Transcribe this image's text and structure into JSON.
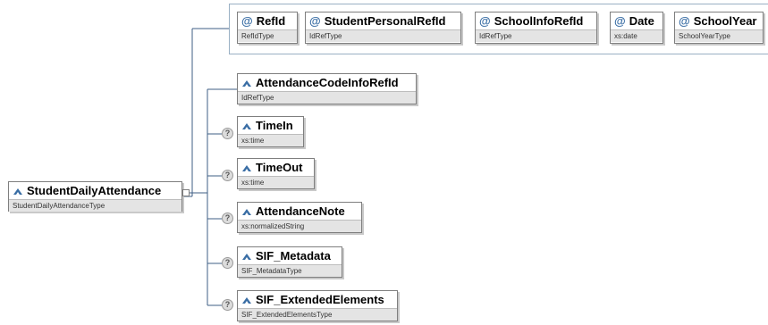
{
  "root": {
    "name": "StudentDailyAttendance",
    "type": "StudentDailyAttendanceType"
  },
  "attributes": [
    {
      "name": "RefId",
      "type": "RefIdType"
    },
    {
      "name": "StudentPersonalRefId",
      "type": "IdRefType"
    },
    {
      "name": "SchoolInfoRefId",
      "type": "IdRefType"
    },
    {
      "name": "Date",
      "type": "xs:date"
    },
    {
      "name": "SchoolYear",
      "type": "SchoolYearType"
    }
  ],
  "elements": [
    {
      "name": "AttendanceCodeInfoRefId",
      "type": "IdRefType",
      "optional": false
    },
    {
      "name": "TimeIn",
      "type": "xs:time",
      "optional": true
    },
    {
      "name": "TimeOut",
      "type": "xs:time",
      "optional": true
    },
    {
      "name": "AttendanceNote",
      "type": "xs:normalizedString",
      "optional": true
    },
    {
      "name": "SIF_Metadata",
      "type": "SIF_MetadataType",
      "optional": true
    },
    {
      "name": "SIF_ExtendedElements",
      "type": "SIF_ExtendedElementsType",
      "optional": true
    }
  ],
  "colors": {
    "connector": "#3f5f86",
    "element_icon": "#3a6ea5",
    "type_bar": "#e4e4e4"
  },
  "icons": {
    "attribute": "at-sign-icon",
    "element": "element-icon",
    "optional": "question-mark-icon"
  }
}
